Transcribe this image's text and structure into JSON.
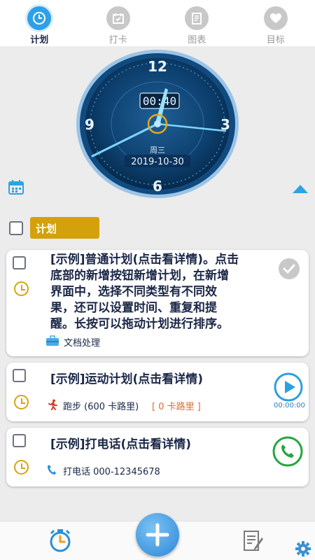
{
  "tabs": [
    {
      "label": "计划",
      "active": true,
      "icon": "clock-icon"
    },
    {
      "label": "打卡",
      "active": false,
      "icon": "calendar-check-icon"
    },
    {
      "label": "图表",
      "active": false,
      "icon": "chart-doc-icon"
    },
    {
      "label": "目标",
      "active": false,
      "icon": "heart-icon"
    }
  ],
  "clock": {
    "digital_time": "00:40",
    "weekday": "周三",
    "date": "2019-10-30",
    "numerals": [
      "12",
      "3",
      "6",
      "9"
    ]
  },
  "section": {
    "tag": "计划"
  },
  "cards": [
    {
      "title_lines": [
        "[示例]普通计划(点击看详情)。点击",
        "底部的新增按钮新增计划，在新增",
        "界面中，选择不同类型有不同效",
        "果，还可以设置时间、重复和提",
        "醒。长按可以拖动计划进行排序。"
      ],
      "sub": "文档处理",
      "sub_icon": "briefcase-icon",
      "action_icon": "done-check-icon"
    },
    {
      "title_lines": [
        "[示例]运动计划(点击看详情)"
      ],
      "sub": "跑步 (600 卡路里)",
      "sub_extra": "[ 0 卡路里 ]",
      "sub_icon": "runner-icon",
      "action_icon": "play-icon",
      "timer": "00:00:00"
    },
    {
      "title_lines": [
        "[示例]打电话(点击看详情)"
      ],
      "sub": "打电话 000-12345678",
      "sub_icon": "phone-icon",
      "action_icon": "phone-call-icon"
    }
  ],
  "colors": {
    "accent": "#2fa0e6",
    "tag": "#d3a10b",
    "clock_face": "#0d3f6e",
    "call_green": "#26a63f"
  }
}
